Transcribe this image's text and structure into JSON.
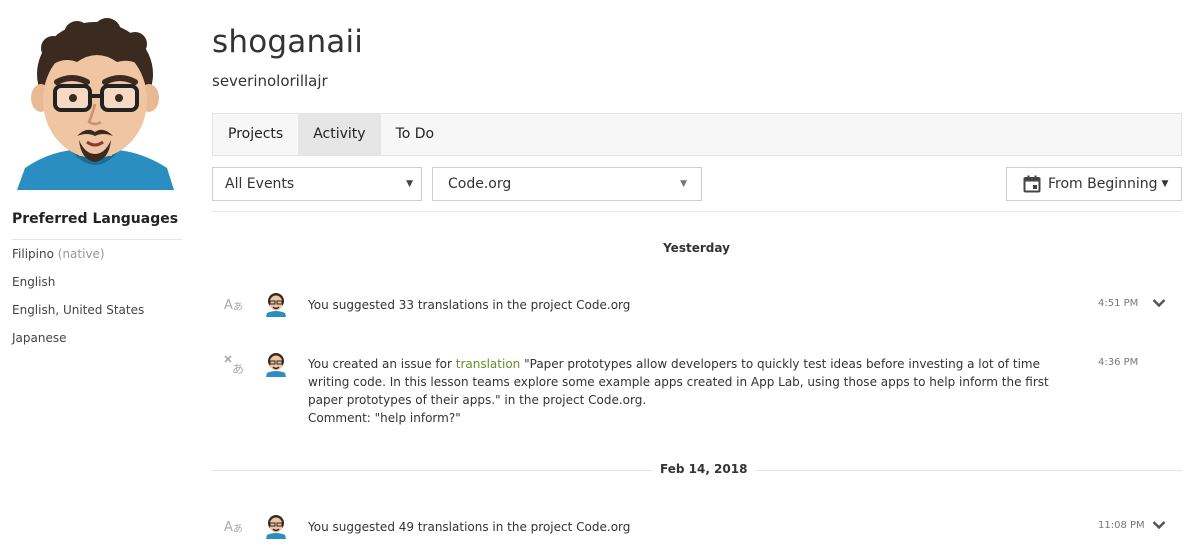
{
  "sidebar": {
    "avatar_name": "avatar",
    "preferred_languages_title": "Preferred Languages",
    "languages": [
      {
        "name": "Filipino",
        "tag": "(native)"
      },
      {
        "name": "English",
        "tag": ""
      },
      {
        "name": "English, United States",
        "tag": ""
      },
      {
        "name": "Japanese",
        "tag": ""
      }
    ]
  },
  "header": {
    "display_name": "shoganaii",
    "username": "severinolorillajr"
  },
  "tabs": [
    {
      "label": "Projects",
      "active": false
    },
    {
      "label": "Activity",
      "active": true
    },
    {
      "label": "To Do",
      "active": false
    }
  ],
  "filters": {
    "events": "All Events",
    "project": "Code.org",
    "date_range": "From Beginning"
  },
  "groups": [
    {
      "date": "Yesterday",
      "items": [
        {
          "icon": "translate-icon",
          "text": "You suggested 33 translations in the project ",
          "project": "Code.org",
          "time": "4:51 PM",
          "expandable": true
        },
        {
          "icon": "issue-translate-icon",
          "text_prefix": "You created an issue for ",
          "link": "translation",
          "text_line1": " \"Paper prototypes allow developers to quickly test ideas before investing a lot of time writing code. In this lesson teams explore some example apps created in App Lab, using those apps to help inform the first paper prototypes of their apps.\" in the project ",
          "project": "Code.org",
          "comment": "Comment: \"help inform?\"",
          "time": "4:36 PM",
          "expandable": false
        }
      ]
    },
    {
      "date": "Feb 14, 2018",
      "items": [
        {
          "icon": "translate-icon",
          "text": "You suggested 49 translations in the project ",
          "project": "Code.org",
          "time": "11:08 PM",
          "expandable": true
        }
      ]
    }
  ],
  "colors": {
    "link": "#6a8e2a",
    "tab_active_bg": "#e6e6e6",
    "tab_bar_bg": "#f7f7f7",
    "avatar_shirt": "#2a8fc0",
    "avatar_hair": "#3a2a20"
  }
}
